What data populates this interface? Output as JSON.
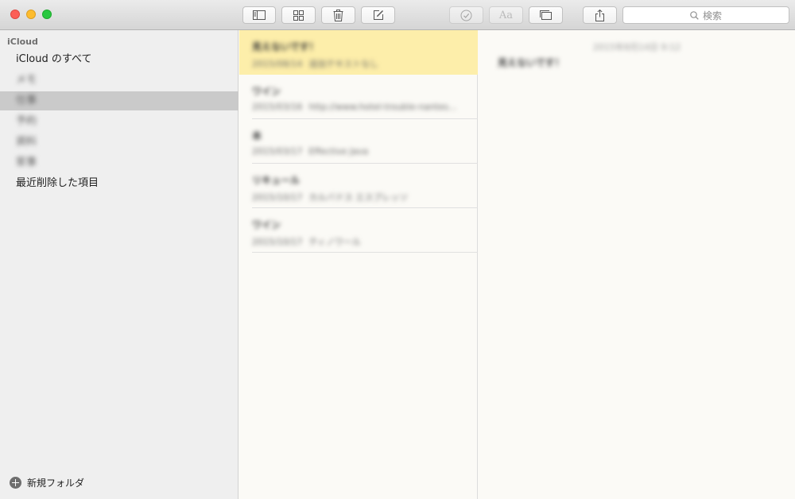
{
  "toolbar": {
    "search_placeholder": "検索",
    "format_label": "Aa"
  },
  "sidebar": {
    "section_title": "iCloud",
    "items": [
      {
        "label": "iCloud のすべて",
        "blurred": false
      },
      {
        "label": "メモ",
        "blurred": true
      },
      {
        "label": "仕事",
        "blurred": true
      },
      {
        "label": "予約",
        "blurred": true
      },
      {
        "label": "資料",
        "blurred": true
      },
      {
        "label": "家事",
        "blurred": true
      },
      {
        "label": "最近削除した項目",
        "blurred": false
      }
    ],
    "selected_index": 2,
    "new_folder_label": "新規フォルダ"
  },
  "notes": [
    {
      "title": "見えないです！",
      "date": "2015/08/14",
      "preview": "追加テキストなし"
    },
    {
      "title": "ワイン",
      "date": "2015/03/16",
      "preview": "http://www.hotel-trouble-nantes..."
    },
    {
      "title": "本",
      "date": "2015/03/17",
      "preview": "Effective Java"
    },
    {
      "title": "リキュール",
      "date": "2015/10/17",
      "preview": "カルバドス エスプレッソ"
    },
    {
      "title": "ワイン",
      "date": "2015/10/17",
      "preview": "ティノワール"
    }
  ],
  "selected_note_index": 0,
  "editor": {
    "date": "2015年8月14日 9:12",
    "body": "見えないです！"
  },
  "colors": {
    "selected_note": "#fdeeaa",
    "sidebar_selected": "#cacaca",
    "close": "#fc5f57",
    "minimize": "#fdbc2e",
    "maximize": "#29c840"
  }
}
